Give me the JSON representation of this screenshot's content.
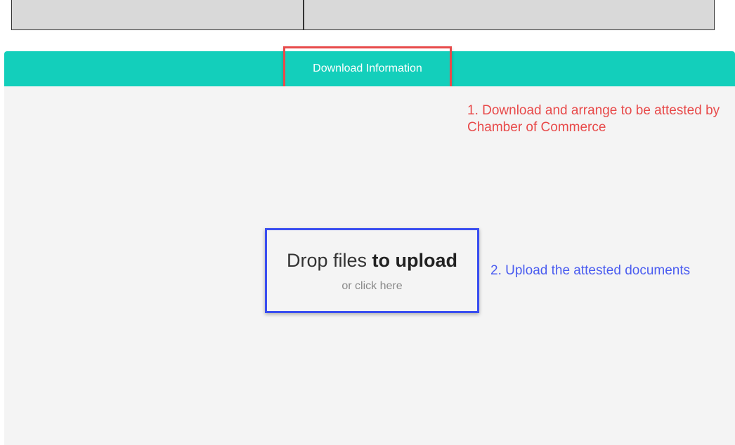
{
  "download": {
    "button_label": "Download Information"
  },
  "annotations": {
    "step1": "1. Download and arrange to be attested by Chamber of Commerce",
    "step2": "2. Upload the attested documents"
  },
  "upload": {
    "title_prefix": "Drop files ",
    "title_emphasis": "to upload",
    "subtitle": "or click here"
  },
  "colors": {
    "header_teal": "#13cfbb",
    "annotation_red": "#e84a4a",
    "annotation_blue": "#4a5cf0"
  }
}
